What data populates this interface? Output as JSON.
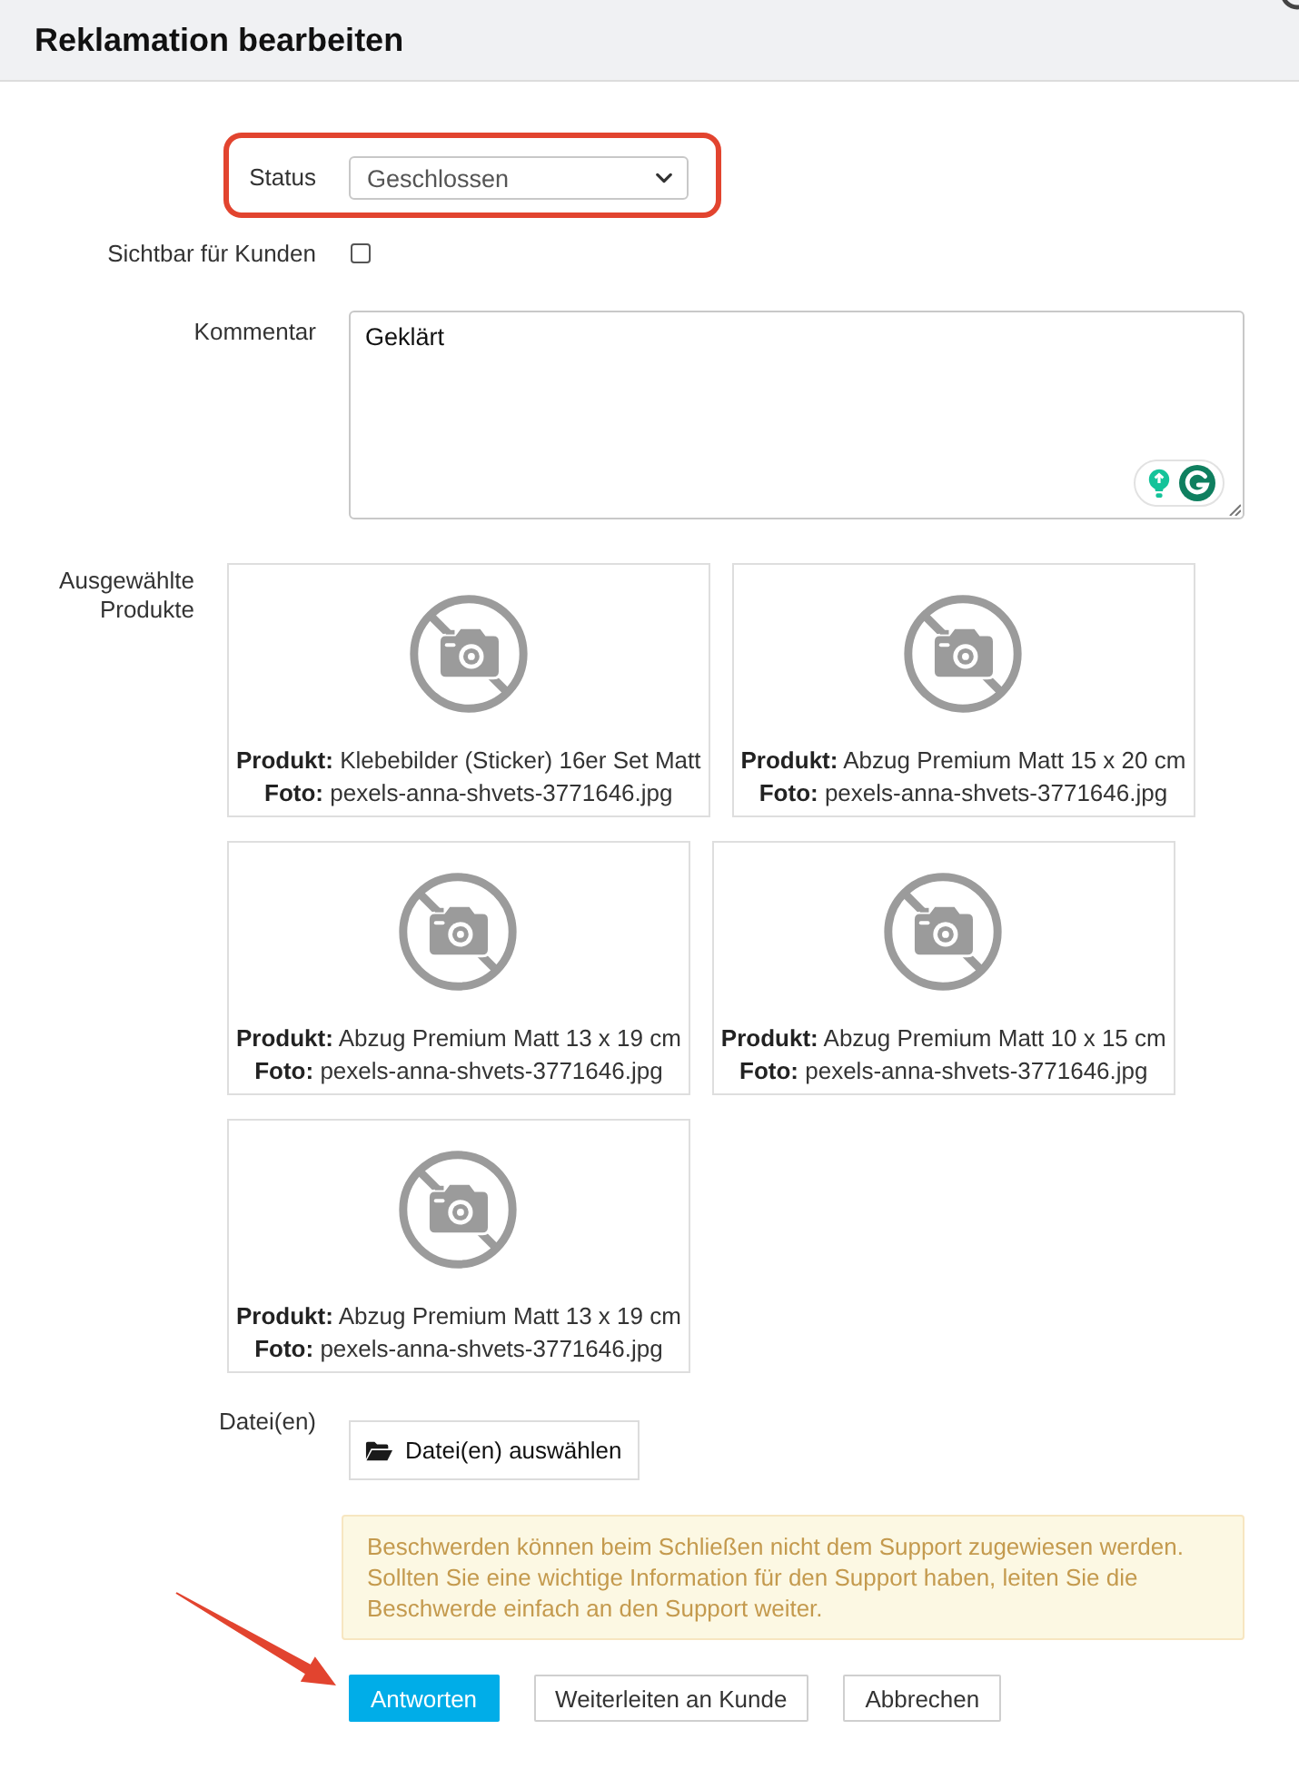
{
  "dialog": {
    "title": "Reklamation bearbeiten"
  },
  "form": {
    "status": {
      "label": "Status",
      "value": "Geschlossen",
      "highlighted": true
    },
    "visible_to_customer": {
      "label": "Sichtbar für Kunden",
      "checked": false
    },
    "comment": {
      "label": "Kommentar",
      "value": "Geklärt"
    },
    "products": {
      "label": "Ausgewählte Produkte",
      "items": [
        {
          "product": "**Produkt:** Klebebilder (Sticker) 16er Set Matt",
          "photo": "**Foto:** pexels-anna-shvets-3771646.jpg"
        },
        {
          "product": "**Produkt:** Abzug Premium Matt 15 x 20 cm",
          "photo": "**Foto:** pexels-anna-shvets-3771646.jpg"
        },
        {
          "product": "**Produkt:** Abzug Premium Matt 13 x 19 cm",
          "photo": "**Foto:** pexels-anna-shvets-3771646.jpg"
        },
        {
          "product": "**Produkt:** Abzug Premium Matt 10 x 15 cm",
          "photo": "**Foto:** pexels-anna-shvets-3771646.jpg"
        },
        {
          "product": "**Produkt:** Abzug Premium Matt 13 x 19 cm",
          "photo": "**Foto:** pexels-anna-shvets-3771646.jpg"
        }
      ]
    },
    "files": {
      "label": "Datei(en)",
      "button": "Datei(en) auswählen"
    }
  },
  "notice": "Beschwerden können beim Schließen nicht dem Support zugewiesen werden. Sollten Sie eine wichtige Information für den Support haben, leiten Sie die Beschwerde einfach an den Support weiter.",
  "buttons": [
    {
      "label": "Antworten",
      "kind": "primary",
      "pointed_at": true
    },
    {
      "label": "Weiterleiten an Kunde",
      "kind": "default",
      "pointed_at": false
    },
    {
      "label": "Abbrechen",
      "kind": "default",
      "pointed_at": false
    }
  ]
}
